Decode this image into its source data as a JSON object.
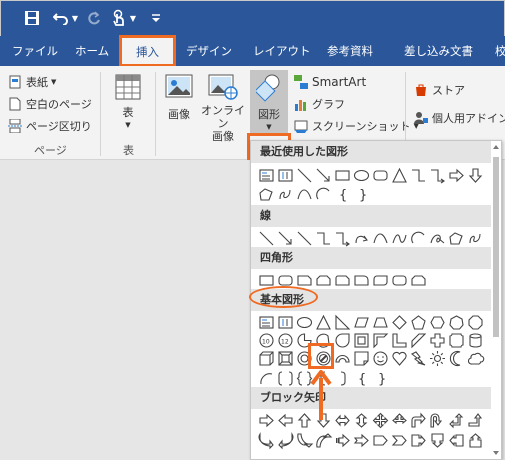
{
  "qat": {
    "save_icon": "save-icon",
    "undo_icon": "undo-icon",
    "redo_icon": "redo-icon",
    "touch_icon": "touch-mode-icon",
    "customize_icon": "customize-qat-icon"
  },
  "tabs": [
    {
      "label": "ファイル"
    },
    {
      "label": "ホーム"
    },
    {
      "label": "挿入"
    },
    {
      "label": "デザイン"
    },
    {
      "label": "レイアウト"
    },
    {
      "label": "参考資料"
    },
    {
      "label": "差し込み文書"
    },
    {
      "label": "校"
    }
  ],
  "ribbon": {
    "pages": {
      "cover": "表紙",
      "blank": "空白のページ",
      "break": "ページ区切り",
      "group": "ページ"
    },
    "table": {
      "label": "表",
      "group": "表"
    },
    "illustrations": {
      "picture": "画像",
      "online_line1": "オンライン",
      "online_line2": "画像",
      "shapes": "図形",
      "smartart": "SmartArt",
      "chart": "グラフ",
      "screenshot": "スクリーンショット"
    },
    "addins": {
      "store": "ストア",
      "my_addins": "個人用アドイン"
    }
  },
  "shapes_panel": {
    "sections": {
      "recent": "最近使用した図形",
      "lines": "線",
      "rectangles": "四角形",
      "basic": "基本図形",
      "block_arrows": "ブロック矢印"
    },
    "braces": [
      "{",
      "}"
    ],
    "basic_nums": [
      "10",
      "12"
    ]
  },
  "colors": {
    "accent_blue": "#2b579a",
    "highlight_orange": "#ef6a23"
  }
}
